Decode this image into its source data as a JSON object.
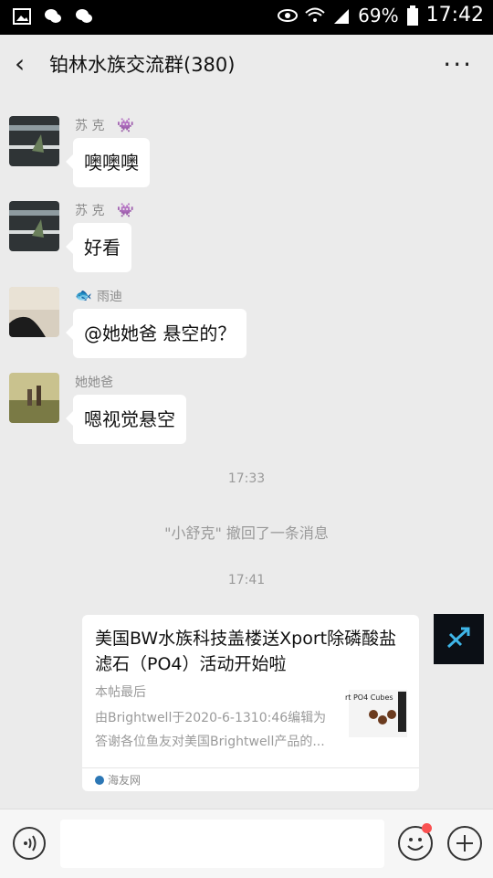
{
  "statusbar": {
    "battery": "69%",
    "time": "17:42"
  },
  "header": {
    "title": "铂林水族交流群(380)",
    "more": "···"
  },
  "messages": [
    {
      "sender": "苏 克",
      "text": "噢噢噢"
    },
    {
      "sender": "苏 克",
      "text": "好看"
    },
    {
      "sender": "雨迪",
      "text": "@她她爸  悬空的？"
    },
    {
      "sender": "她她爸",
      "text": "嗯视觉悬空"
    }
  ],
  "timestamps": [
    "17:33",
    "17:41"
  ],
  "system_notice": "\"小舒克\" 撤回了一条消息",
  "card": {
    "title": "美国BW水族科技盖楼送Xport除磷酸盐滤石（PO4）活动开始啦",
    "sub1": "本帖最后",
    "sub2": "由Brightwell于2020-6-1310:46编辑为答谢各位鱼友对美国Brightwell产品的...",
    "source": "海友网",
    "thumb_text": "rt PO4 Cubes"
  },
  "colors": {
    "accent_red": "#fa5151"
  }
}
